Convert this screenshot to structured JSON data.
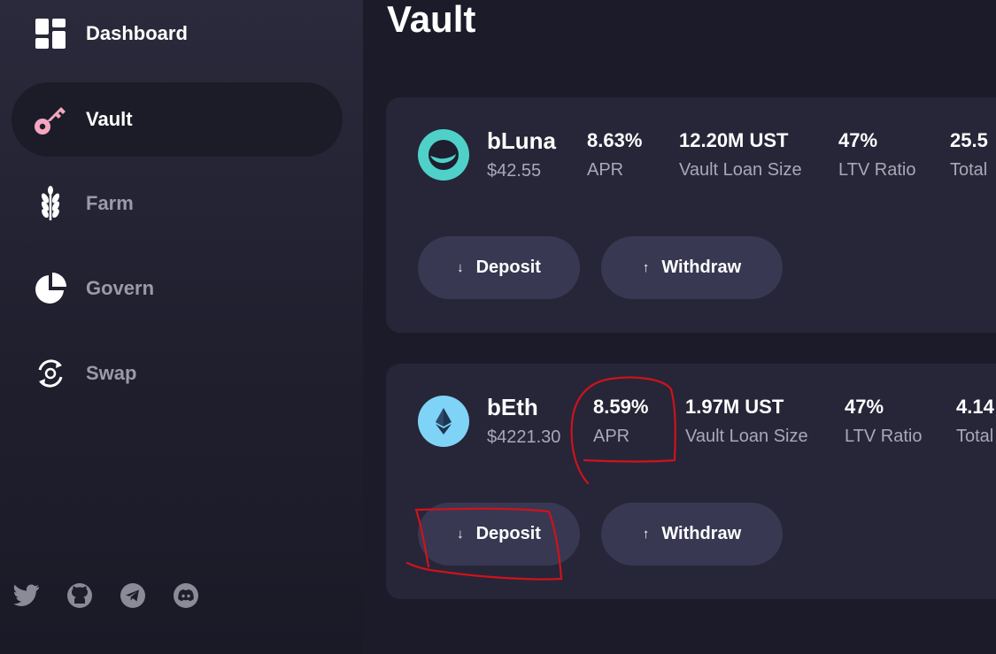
{
  "nav": {
    "dashboard": "Dashboard",
    "vault": "Vault",
    "farm": "Farm",
    "govern": "Govern",
    "swap": "Swap",
    "active": "Vault"
  },
  "socials": [
    "twitter-icon",
    "github-icon",
    "telegram-icon",
    "discord-icon"
  ],
  "page": {
    "title": "Vault"
  },
  "vaults": [
    {
      "name": "bLuna",
      "price": "$42.55",
      "icon": "luna-icon",
      "icon_color": "#4fd1c9",
      "stats": [
        {
          "value": "8.63%",
          "label": "APR"
        },
        {
          "value": "12.20M UST",
          "label": "Vault Loan Size"
        },
        {
          "value": "47%",
          "label": "LTV Ratio"
        },
        {
          "value": "25.5",
          "label": "Total"
        }
      ],
      "deposit_label": "Deposit",
      "withdraw_label": "Withdraw"
    },
    {
      "name": "bEth",
      "price": "$4221.30",
      "icon": "ethereum-icon",
      "icon_color": "#7fd3f7",
      "stats": [
        {
          "value": "8.59%",
          "label": "APR"
        },
        {
          "value": "1.97M UST",
          "label": "Vault Loan Size"
        },
        {
          "value": "47%",
          "label": "LTV Ratio"
        },
        {
          "value": "4.14",
          "label": "Total"
        }
      ],
      "deposit_label": "Deposit",
      "withdraw_label": "Withdraw"
    }
  ],
  "colors": {
    "background": "#1b1b29",
    "card": "#262638",
    "button": "#383852",
    "vault_icon": "#f4a6c0",
    "annotation": "#d0121b"
  }
}
